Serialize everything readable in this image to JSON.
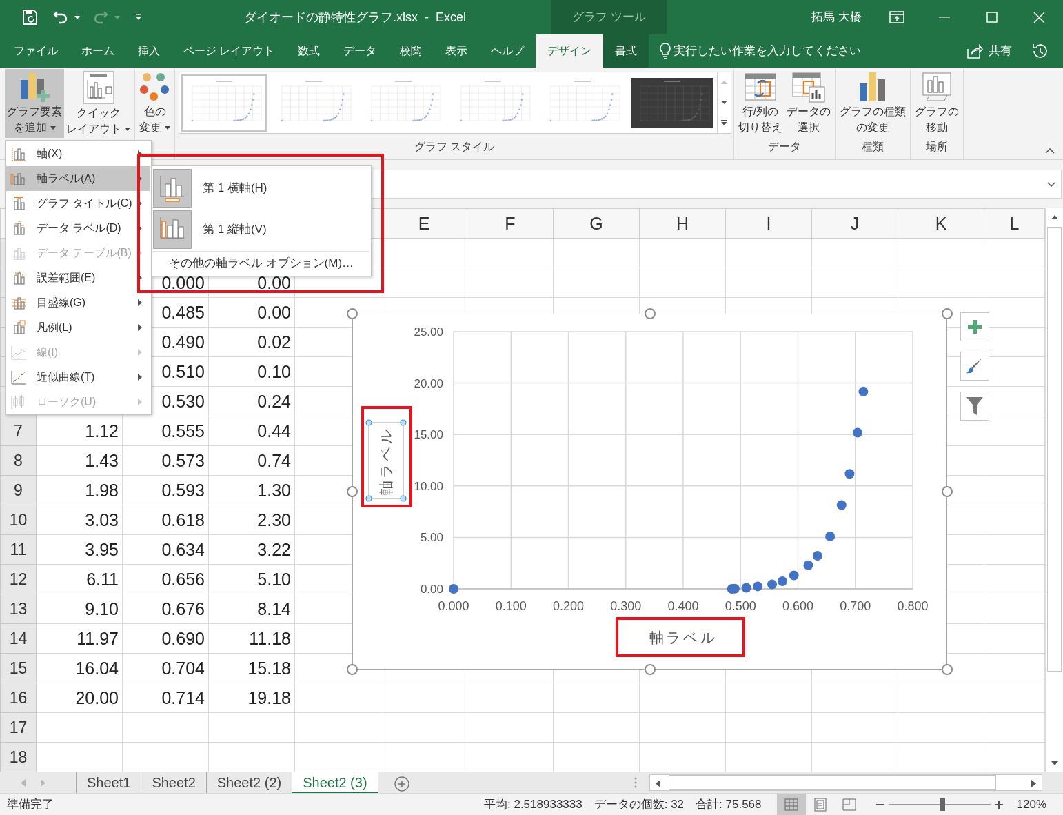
{
  "title_bar": {
    "title": "ダイオードの静特性グラフ.xlsx  -  Excel",
    "context_label": "グラフ ツール",
    "user": "拓馬 大橋"
  },
  "ribbon_tabs": [
    {
      "label": "ファイル",
      "selected": false,
      "context": false
    },
    {
      "label": "ホーム",
      "selected": false,
      "context": false
    },
    {
      "label": "挿入",
      "selected": false,
      "context": false
    },
    {
      "label": "ページ レイアウト",
      "selected": false,
      "context": false
    },
    {
      "label": "数式",
      "selected": false,
      "context": false
    },
    {
      "label": "データ",
      "selected": false,
      "context": false
    },
    {
      "label": "校閲",
      "selected": false,
      "context": false
    },
    {
      "label": "表示",
      "selected": false,
      "context": false
    },
    {
      "label": "ヘルプ",
      "selected": false,
      "context": false
    },
    {
      "label": "デザイン",
      "selected": true,
      "context": true
    },
    {
      "label": "書式",
      "selected": false,
      "context": true
    }
  ],
  "tell_me": "実行したい作業を入力してください",
  "share": "共有",
  "ribbon": {
    "groups": [
      {
        "buttons": [
          {
            "lines": [
              "グラフ要素",
              "を追加"
            ],
            "dropdown": true,
            "pressed": true
          },
          {
            "lines": [
              "クイック",
              "レイアウト"
            ],
            "dropdown": true,
            "pressed": false
          }
        ]
      },
      {
        "buttons": [
          {
            "lines": [
              "色の",
              "変更"
            ],
            "dropdown": true,
            "pressed": false
          }
        ]
      },
      {
        "label": "グラフ スタイル",
        "styles": [
          {
            "selected": true,
            "dark": false
          },
          {
            "selected": false,
            "dark": false
          },
          {
            "selected": false,
            "dark": false
          },
          {
            "selected": false,
            "dark": false
          },
          {
            "selected": false,
            "dark": false
          },
          {
            "selected": false,
            "dark": true
          }
        ]
      },
      {
        "label": "データ",
        "buttons": [
          {
            "lines": [
              "行/列の",
              "切り替え"
            ],
            "dropdown": false,
            "pressed": false
          },
          {
            "lines": [
              "データの",
              "選択"
            ],
            "dropdown": false,
            "pressed": false
          }
        ]
      },
      {
        "label": "種類",
        "buttons": [
          {
            "lines": [
              "グラフの種類",
              "の変更"
            ],
            "dropdown": false,
            "pressed": false
          }
        ]
      },
      {
        "label": "場所",
        "buttons": [
          {
            "lines": [
              "グラフの",
              "移動"
            ],
            "dropdown": false,
            "pressed": false
          }
        ]
      }
    ]
  },
  "chart_element_menu": {
    "items": [
      {
        "label": "軸(X)",
        "selected": false,
        "disabled": false
      },
      {
        "label": "軸ラベル(A)",
        "selected": true,
        "disabled": false
      },
      {
        "label": "グラフ タイトル(C)",
        "selected": false,
        "disabled": false
      },
      {
        "label": "データ ラベル(D)",
        "selected": false,
        "disabled": false
      },
      {
        "label": "データ テーブル(B)",
        "selected": false,
        "disabled": true
      },
      {
        "label": "誤差範囲(E)",
        "selected": false,
        "disabled": false
      },
      {
        "label": "目盛線(G)",
        "selected": false,
        "disabled": false
      },
      {
        "label": "凡例(L)",
        "selected": false,
        "disabled": false
      },
      {
        "label": "線(I)",
        "selected": false,
        "disabled": true
      },
      {
        "label": "近似曲線(T)",
        "selected": false,
        "disabled": false
      },
      {
        "label": "ローソク(U)",
        "selected": false,
        "disabled": true
      }
    ]
  },
  "axis_label_submenu": {
    "items": [
      {
        "label": "第 1 横軸(H)",
        "kind": "icon"
      },
      {
        "label": "第 1 縦軸(V)",
        "kind": "icon"
      },
      {
        "label": "その他の軸ラベル オプション(M)…",
        "kind": "text"
      }
    ]
  },
  "sheet": {
    "columns": [
      null,
      null,
      null,
      null,
      "E",
      "F",
      "G",
      "H",
      "I",
      "J",
      "K",
      "L"
    ],
    "rows": [
      {},
      {
        "cells": [
          null,
          "0.000",
          "0.00"
        ]
      },
      {
        "cells": [
          null,
          "0.485",
          "0.00"
        ]
      },
      {
        "cells": [
          null,
          "0.490",
          "0.02"
        ]
      },
      {
        "cells": [
          null,
          "0.510",
          "0.10"
        ]
      },
      {
        "cells": [
          null,
          "0.530",
          "0.24"
        ]
      },
      {
        "number": "7",
        "cells": [
          "1.12",
          "0.555",
          "0.44"
        ]
      },
      {
        "number": "8",
        "cells": [
          "1.43",
          "0.573",
          "0.74"
        ]
      },
      {
        "number": "9",
        "cells": [
          "1.98",
          "0.593",
          "1.30"
        ]
      },
      {
        "number": "10",
        "cells": [
          "3.03",
          "0.618",
          "2.30"
        ]
      },
      {
        "number": "11",
        "cells": [
          "3.95",
          "0.634",
          "3.22"
        ]
      },
      {
        "number": "12",
        "cells": [
          "6.11",
          "0.656",
          "5.10"
        ]
      },
      {
        "number": "13",
        "cells": [
          "9.10",
          "0.676",
          "8.14"
        ]
      },
      {
        "number": "14",
        "cells": [
          "11.97",
          "0.690",
          "11.18"
        ]
      },
      {
        "number": "15",
        "cells": [
          "16.04",
          "0.704",
          "15.18"
        ]
      },
      {
        "number": "16",
        "cells": [
          "20.00",
          "0.714",
          "19.18"
        ]
      },
      {
        "number": "17"
      },
      {
        "number": "18"
      }
    ]
  },
  "chart": {
    "ylabel_selected": true,
    "chart_data": {
      "type": "scatter",
      "xlabel": "軸ラベル",
      "ylabel": "軸ラベル",
      "x": [
        0.0,
        0.485,
        0.49,
        0.51,
        0.53,
        0.555,
        0.573,
        0.593,
        0.618,
        0.634,
        0.656,
        0.676,
        0.69,
        0.704,
        0.714
      ],
      "grid": true,
      "series": [
        {
          "color": "#4472c4",
          "values": [
            0.0,
            0.0,
            0.02,
            0.1,
            0.24,
            0.44,
            0.74,
            1.3,
            2.3,
            3.22,
            5.1,
            8.14,
            11.18,
            15.18,
            19.18
          ]
        }
      ],
      "xlim": [
        0,
        0.8
      ],
      "ylim": [
        0,
        25
      ],
      "xticks": [
        {
          "value": 0,
          "label": "0.000"
        },
        {
          "value": 0.1,
          "label": "0.100"
        },
        {
          "value": 0.2,
          "label": "0.200"
        },
        {
          "value": 0.3,
          "label": "0.300"
        },
        {
          "value": 0.4,
          "label": "0.400"
        },
        {
          "value": 0.5,
          "label": "0.500"
        },
        {
          "value": 0.6,
          "label": "0.600"
        },
        {
          "value": 0.7,
          "label": "0.700"
        },
        {
          "value": 0.8,
          "label": "0.800"
        }
      ],
      "yticks": [
        {
          "value": 0,
          "label": "0.00"
        },
        {
          "value": 5,
          "label": "5.00"
        },
        {
          "value": 10,
          "label": "10.00"
        },
        {
          "value": 15,
          "label": "15.00"
        },
        {
          "value": 20,
          "label": "20.00"
        },
        {
          "value": 25,
          "label": "25.00"
        }
      ]
    }
  },
  "sheet_tabs": [
    {
      "label": "Sheet1",
      "selected": false
    },
    {
      "label": "Sheet2",
      "selected": false
    },
    {
      "label": "Sheet2 (2)",
      "selected": false
    },
    {
      "label": "Sheet2 (3)",
      "selected": true
    }
  ],
  "status_bar": {
    "ready": "準備完了",
    "stats": [
      "平均: 2.518933333",
      "データの個数: 32",
      "合計: 75.568"
    ],
    "views": [
      {
        "selected": true
      },
      {
        "selected": false
      },
      {
        "selected": false
      }
    ],
    "zoom": {
      "level": 0.53,
      "reading": "120%"
    }
  }
}
